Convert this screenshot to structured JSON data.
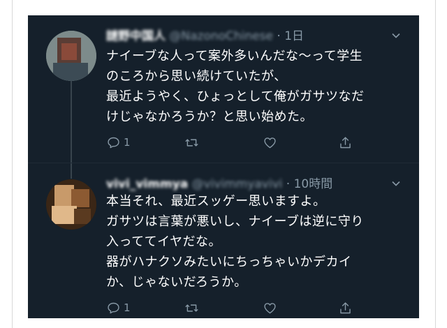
{
  "tweets": [
    {
      "display_name": "謎野中国人",
      "handle": "@NazonoChinese",
      "time": "1日",
      "lines": [
        "ナイーブな人って案外多いんだな〜って学生",
        "のころから思い続けていたが、",
        "最近ようやく、ひょっとして俺がガサツなだ",
        "けじゃなかろうか？と思い始めた。"
      ],
      "reply_count": "1",
      "retweet_count": "",
      "like_count": ""
    },
    {
      "display_name": "vivi_vimmya",
      "handle": "@vivimmyavivi",
      "time": "10時間",
      "lines": [
        "本当それ、最近スッゲー思いますよ。",
        "ガサツは言葉が悪いし、ナイーブは逆に守り",
        "入っててイヤだな。",
        "器がハナクソみたいにちっちゃいかデカイ",
        "か、じゃないだろうか。"
      ],
      "reply_count": "1",
      "retweet_count": "",
      "like_count": ""
    }
  ],
  "separator_dot": "·",
  "colors": {
    "background": "#15202b",
    "text": "#ffffff",
    "muted": "#8899a6",
    "thread_line": "#38444d"
  },
  "icons": [
    "reply-icon",
    "retweet-icon",
    "like-icon",
    "share-icon",
    "chevron-down-icon"
  ]
}
